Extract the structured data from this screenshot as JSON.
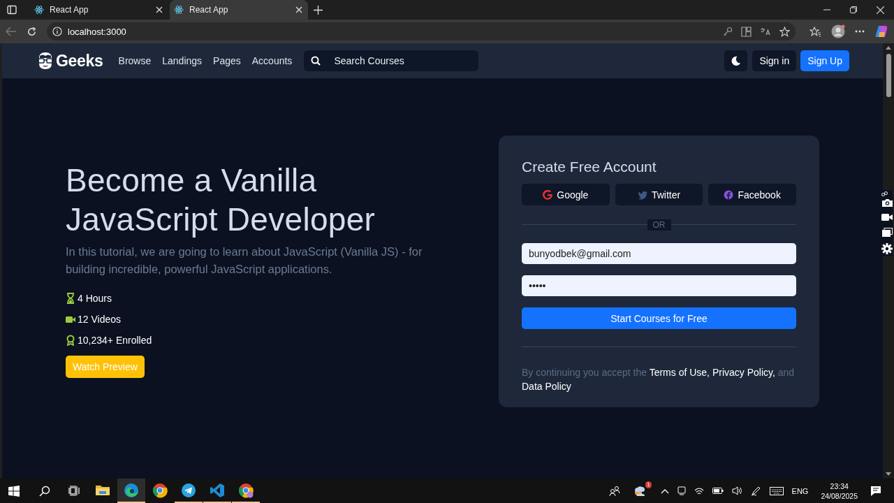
{
  "browser": {
    "tabs": [
      {
        "title": "React App",
        "selected": false
      },
      {
        "title": "React App",
        "selected": true
      }
    ],
    "address": "localhost:3000"
  },
  "navbar": {
    "brand": "Geeks",
    "links": [
      "Browse",
      "Landings",
      "Pages",
      "Accounts"
    ],
    "search": {
      "placeholder": "Search Courses"
    },
    "buttons": [
      {
        "label": "Sign in",
        "kind": "dark"
      },
      {
        "label": "Sign Up",
        "kind": "primary"
      }
    ]
  },
  "hero": {
    "title": "Become a Vanilla JavaScript Developer",
    "description": "In this tutorial, we are going to learn about JavaScript (Vanilla JS) - for building incredible, powerful JavaScript applications.",
    "features": [
      {
        "kind": "hours",
        "text": "4 Hours"
      },
      {
        "kind": "videos",
        "text": "12 Videos"
      },
      {
        "kind": "enrolled",
        "text": "10,234+ Enrolled"
      }
    ],
    "button": "Watch Preview"
  },
  "signup": {
    "title": "Create Free Account",
    "social": [
      {
        "kind": "google",
        "label": "Google"
      },
      {
        "kind": "twitter",
        "label": "Twitter"
      },
      {
        "kind": "facebook",
        "label": "Facebook"
      }
    ],
    "divider": "OR",
    "email": {
      "value": "bunyodbek@gmail.com"
    },
    "password": {
      "value": "•••••"
    },
    "submit": "Start Courses for Free",
    "legal": [
      {
        "kind": "plain",
        "text": "By continuing you accept the "
      },
      {
        "kind": "link",
        "text": "Terms of Use, Privacy Policy,"
      },
      {
        "kind": "plain",
        "text": " and "
      },
      {
        "kind": "link",
        "text": "Data Policy"
      }
    ]
  },
  "taskbar": {
    "apps": [
      {
        "kind": "explorer",
        "running": false,
        "selected": false
      },
      {
        "kind": "edge",
        "running": true,
        "selected": true
      },
      {
        "kind": "chrome",
        "running": false,
        "selected": false
      },
      {
        "kind": "telegram",
        "running": true,
        "selected": false
      },
      {
        "kind": "vscode",
        "running": true,
        "selected": false
      },
      {
        "kind": "chrome-profile",
        "running": true,
        "selected": false
      }
    ],
    "tray": {
      "badge": "1",
      "language": "ENG",
      "time": "23:34",
      "date": "24/08/2025"
    }
  }
}
